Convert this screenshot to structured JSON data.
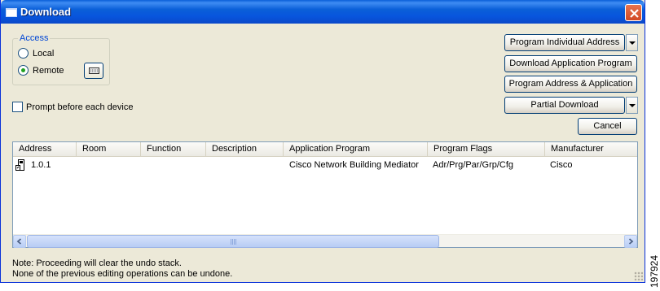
{
  "window": {
    "title": "Download"
  },
  "access": {
    "legend": "Access",
    "options": [
      {
        "label": "Local",
        "checked": false
      },
      {
        "label": "Remote",
        "checked": true
      }
    ]
  },
  "prompt": {
    "label": "Prompt before each device",
    "checked": false
  },
  "buttons": {
    "program_individual_address": "Program Individual Address",
    "download_application_program": "Download Application Program",
    "program_address_application": "Program Address & Application",
    "partial_download": "Partial Download",
    "cancel": "Cancel"
  },
  "table": {
    "columns": [
      "Address",
      "Room",
      "Function",
      "Description",
      "Application Program",
      "Program Flags",
      "Manufacturer"
    ],
    "rows": [
      {
        "Address": "1.0.1",
        "Room": "",
        "Function": "",
        "Description": "",
        "Application Program": "Cisco Network Building Mediator",
        "Program Flags": "Adr/Prg/Par/Grp/Cfg",
        "Manufacturer": "Cisco"
      }
    ]
  },
  "notes": [
    "Note: Proceeding will clear the undo stack.",
    "None of the previous editing operations can be undone."
  ],
  "figure_id": "197924",
  "colors": {
    "titlebar": "#0a5fd8",
    "window_bg": "#ece9d8",
    "accent_legend": "#0046d5"
  },
  "icons": [
    "window-icon",
    "close-icon",
    "keyboard-icon",
    "device-icon",
    "scroll-left-icon",
    "scroll-right-icon",
    "dropdown-arrow-icon"
  ]
}
